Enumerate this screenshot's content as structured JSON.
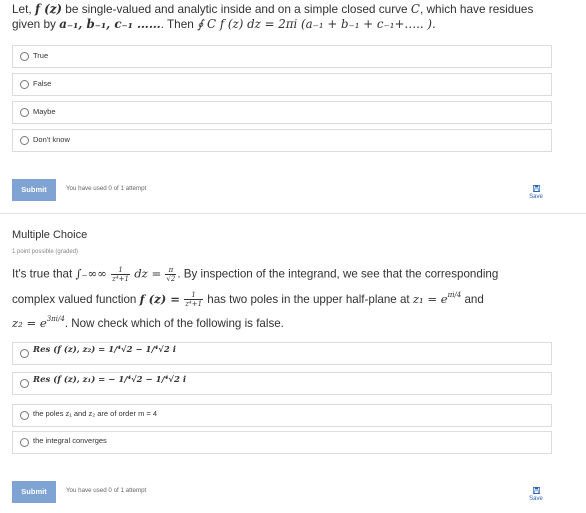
{
  "question1": {
    "intro_a": "Let,",
    "f_z": "f (z)",
    "intro_b": "be single-valued and analytic inside and on a simple closed curve",
    "curve": "C",
    "intro_c": ", which have residues",
    "given_by": "given by",
    "residues": "a₋₁, b₋₁, c₋₁ ……",
    "then": ". Then",
    "integral": "∮ C f (z) dz = 2πi (a₋₁ + b₋₁ + c₋₁+….. ).",
    "options": [
      "True",
      "False",
      "Maybe",
      "Don't know"
    ]
  },
  "submit_label": "Submit",
  "attempts_text": "You have used 0 of 1 attempt",
  "save_label": "Save",
  "question2": {
    "heading": "Multiple Choice",
    "points": "1 point possible (graded)",
    "l1_a": "It's true that",
    "l1_integral": "∫₋∞∞",
    "l1_frac_num": "1",
    "l1_frac_den": "z⁴+1",
    "l1_dz": "dz =",
    "l1_rhs_num": "π",
    "l1_rhs_den": "√2",
    "l1_b": ". By inspection of the integrand, we see that the corresponding",
    "l2_a": "complex valued function",
    "l2_f": "f (z) =",
    "l2_frac_num": "1",
    "l2_frac_den": "z⁴+1",
    "l2_b": "has two poles in the upper half-plane at",
    "l2_z1": "z₁ = e",
    "l2_z1_exp": "πi/4",
    "l2_and": "and",
    "l3_z2": "z₂ = e",
    "l3_z2_exp": "3πi/4",
    "l3_b": ". Now check which of the following is false.",
    "options": [
      "Res (f (z), z₂) = 1/⁴√2 − 1/⁴√2 i",
      "Res (f (z), z₁) = − 1/⁴√2 − 1/⁴√2 i",
      "the poles z₁ and z₂ are of order m = 4",
      "the integral converges"
    ]
  }
}
